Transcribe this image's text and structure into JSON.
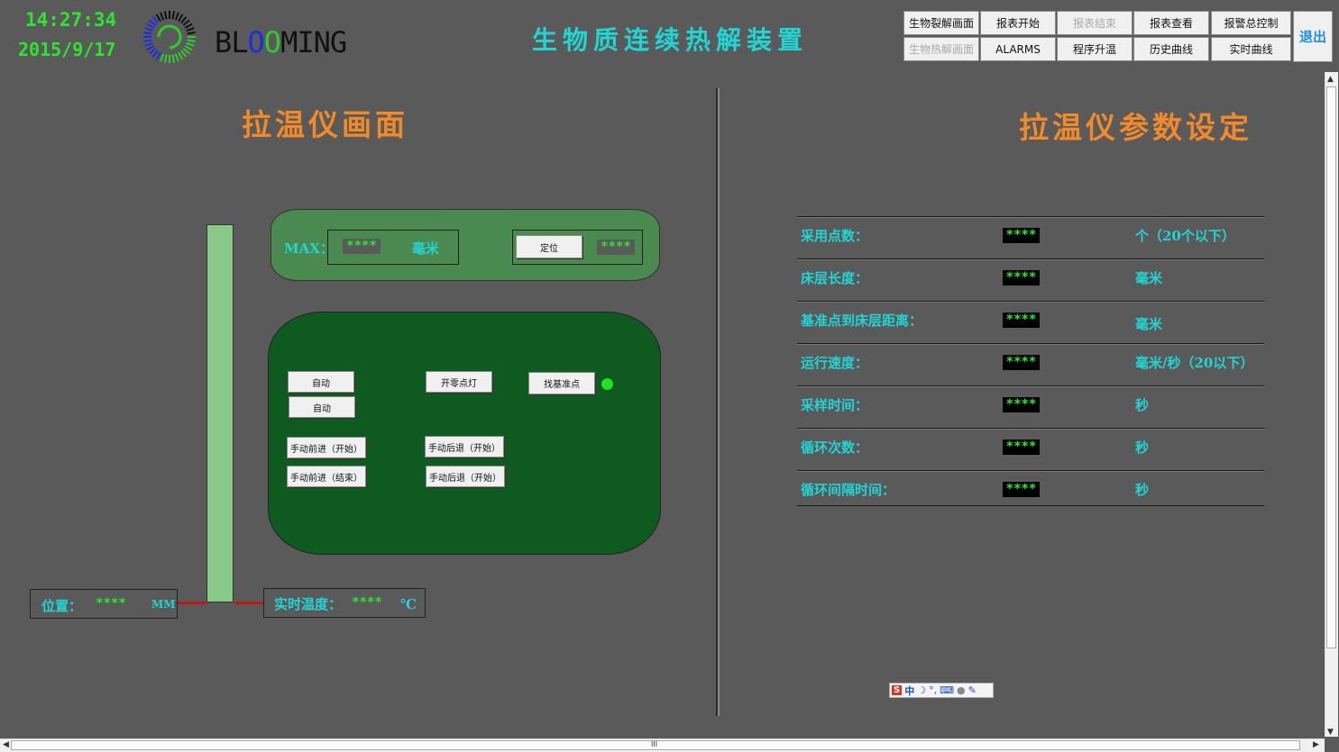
{
  "header": {
    "time": "14:27:34",
    "date": "2015/9/17",
    "brand": [
      "B",
      "L",
      "O",
      "O",
      "M",
      "I",
      "N",
      "G"
    ],
    "brand_colors": [
      "#111111",
      "#111111",
      "#1a2ee0",
      "#2ecc2e",
      "#111111",
      "#111111",
      "#111111",
      "#111111"
    ],
    "title": "生物质连续热解装置",
    "nav_row1": [
      {
        "label": "生物裂解画面",
        "disabled": false
      },
      {
        "label": "报表开始",
        "disabled": false
      },
      {
        "label": "报表结束",
        "disabled": true
      },
      {
        "label": "报表查看",
        "disabled": false
      },
      {
        "label": "报警总控制",
        "disabled": false
      }
    ],
    "nav_row2": [
      {
        "label": "生物热解画面",
        "disabled": true
      },
      {
        "label": "ALARMS",
        "disabled": false
      },
      {
        "label": "程序升温",
        "disabled": false
      },
      {
        "label": "历史曲线",
        "disabled": false
      },
      {
        "label": "实时曲线",
        "disabled": false
      }
    ],
    "exit_label": "退出"
  },
  "left": {
    "title": "拉温仪画面",
    "max_label": "MAX：",
    "max_value": "****",
    "max_unit": "毫米",
    "locate_button": "定位",
    "locate_value": "****",
    "buttons": {
      "auto1": "自动",
      "auto2": "自动",
      "zero_light": "开零点灯",
      "find_ref": "找基准点",
      "fwd_start": "手动前进（开始）",
      "fwd_end": "手动前进（结束）",
      "back_start1": "手动后退（开始）",
      "back_start2": "手动后退（开始）"
    },
    "position_label": "位置：",
    "position_value": "****",
    "position_unit": "MM",
    "temp_label": "实时温度：",
    "temp_value": "****",
    "temp_unit": "℃",
    "indicator_color": "#22e022"
  },
  "right": {
    "title": "拉温仪参数设定",
    "params": [
      {
        "label": "采用点数：",
        "value": "****",
        "unit": "个（20个以下）"
      },
      {
        "label": "床层长度：",
        "value": "****",
        "unit": "毫米"
      },
      {
        "label": "基准点到床层距离：",
        "value": "****",
        "unit": "毫米"
      },
      {
        "label": "运行速度：",
        "value": "****",
        "unit": "毫米/秒（20以下）"
      },
      {
        "label": "采样时间：",
        "value": "****",
        "unit": "秒"
      },
      {
        "label": "循环次数：",
        "value": "****",
        "unit": "秒"
      },
      {
        "label": "循环间隔时间：",
        "value": "****",
        "unit": "秒"
      }
    ]
  },
  "ime": {
    "s": "S",
    "mode": "中"
  },
  "scroll": {
    "h_mark": "III"
  }
}
